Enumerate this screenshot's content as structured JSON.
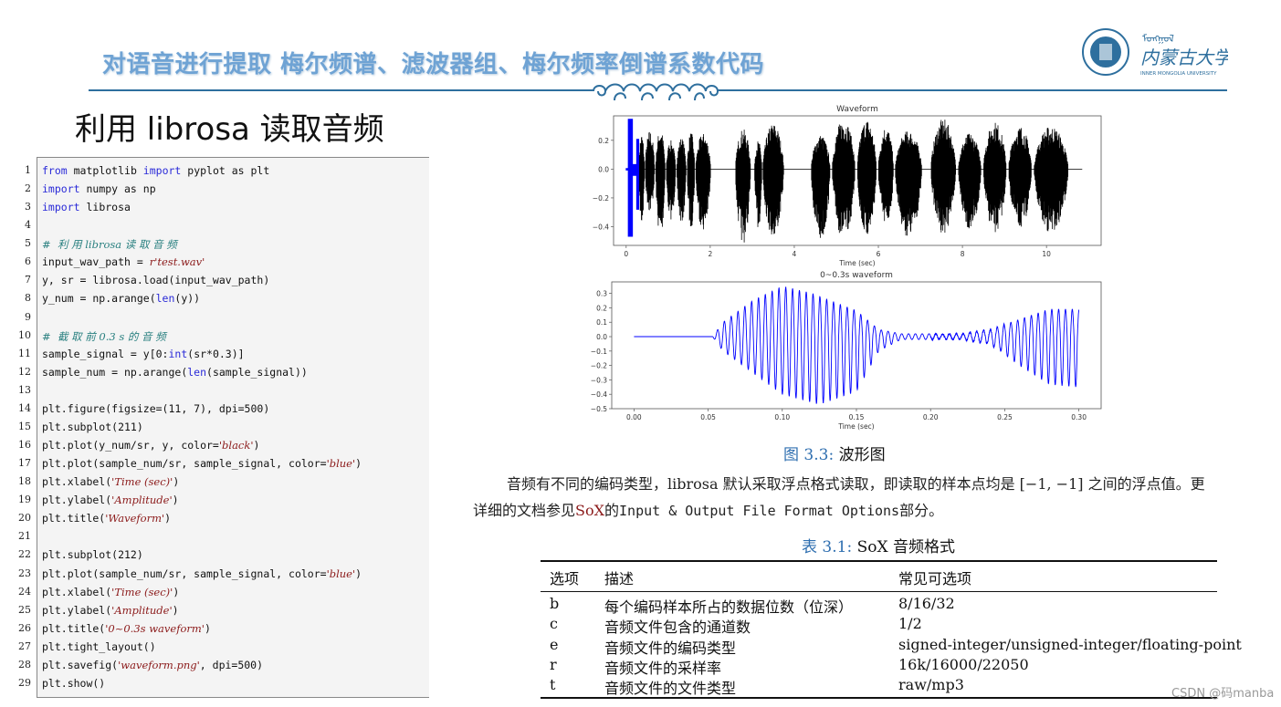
{
  "header": {
    "title": "对语音进行提取  梅尔频谱、滤波器组、梅尔频率倒谱系数代码",
    "logo_text": "内蒙古大学 INNER MONGOLIA UNIVERSITY",
    "accent_color": "#2e6f9e",
    "title_color": "#6fa3d4"
  },
  "section_heading": "利用 librosa 读取音频",
  "code": {
    "line_numbers": [
      "1",
      "2",
      "3",
      "4",
      "5",
      "6",
      "7",
      "8",
      "9",
      "10",
      "11",
      "12",
      "13",
      "14",
      "15",
      "16",
      "17",
      "18",
      "19",
      "20",
      "21",
      "22",
      "23",
      "24",
      "25",
      "26",
      "27",
      "28",
      "29"
    ],
    "lines": [
      [
        [
          "kw",
          "from"
        ],
        [
          "t",
          " matplotlib "
        ],
        [
          "kw",
          "import"
        ],
        [
          "t",
          " pyplot as plt"
        ]
      ],
      [
        [
          "kw",
          "import"
        ],
        [
          "t",
          " numpy as np"
        ]
      ],
      [
        [
          "kw",
          "import"
        ],
        [
          "t",
          " librosa"
        ]
      ],
      [],
      [
        [
          "cm",
          "#  利 用 librosa 读 取 音 频"
        ]
      ],
      [
        [
          "t",
          "input_wav_path = "
        ],
        [
          "st",
          "r'test.wav'"
        ]
      ],
      [
        [
          "t",
          "y, sr = librosa.load(input_wav_path)"
        ]
      ],
      [
        [
          "t",
          "y_num = np.arange("
        ],
        [
          "kw",
          "len"
        ],
        [
          "t",
          "(y))"
        ]
      ],
      [],
      [
        [
          "cm",
          "#  截 取 前 0.3 s 的 音 频"
        ]
      ],
      [
        [
          "t",
          "sample_signal = y[0:"
        ],
        [
          "kw",
          "int"
        ],
        [
          "t",
          "(sr*0.3)]"
        ]
      ],
      [
        [
          "t",
          "sample_num = np.arange("
        ],
        [
          "kw",
          "len"
        ],
        [
          "t",
          "(sample_signal))"
        ]
      ],
      [],
      [
        [
          "t",
          "plt.figure(figsize=(11, 7), dpi=500)"
        ]
      ],
      [
        [
          "t",
          "plt.subplot(211)"
        ]
      ],
      [
        [
          "t",
          "plt.plot(y_num/sr, y, color="
        ],
        [
          "st",
          "'black'"
        ],
        [
          "t",
          ")"
        ]
      ],
      [
        [
          "t",
          "plt.plot(sample_num/sr, sample_signal, color="
        ],
        [
          "st",
          "'blue'"
        ],
        [
          "t",
          ")"
        ]
      ],
      [
        [
          "t",
          "plt.xlabel("
        ],
        [
          "st",
          "'Time (sec)'"
        ],
        [
          "t",
          ")"
        ]
      ],
      [
        [
          "t",
          "plt.ylabel("
        ],
        [
          "st",
          "'Amplitude'"
        ],
        [
          "t",
          ")"
        ]
      ],
      [
        [
          "t",
          "plt.title("
        ],
        [
          "st",
          "'Waveform'"
        ],
        [
          "t",
          ")"
        ]
      ],
      [],
      [
        [
          "t",
          "plt.subplot(212)"
        ]
      ],
      [
        [
          "t",
          "plt.plot(sample_num/sr, sample_signal, color="
        ],
        [
          "st",
          "'blue'"
        ],
        [
          "t",
          ")"
        ]
      ],
      [
        [
          "t",
          "plt.xlabel("
        ],
        [
          "st",
          "'Time (sec)'"
        ],
        [
          "t",
          ")"
        ]
      ],
      [
        [
          "t",
          "plt.ylabel("
        ],
        [
          "st",
          "'Amplitude'"
        ],
        [
          "t",
          ")"
        ]
      ],
      [
        [
          "t",
          "plt.title("
        ],
        [
          "st",
          "'0~0.3s waveform'"
        ],
        [
          "t",
          ")"
        ]
      ],
      [
        [
          "t",
          "plt.tight_layout()"
        ]
      ],
      [
        [
          "t",
          "plt.savefig("
        ],
        [
          "st",
          "'waveform.png'"
        ],
        [
          "t",
          ", dpi=500)"
        ]
      ],
      [
        [
          "t",
          "plt.show()"
        ]
      ]
    ]
  },
  "chart_data": [
    {
      "type": "line",
      "title": "Waveform",
      "xlabel": "Time (sec)",
      "ylabel": "",
      "xlim": [
        -0.3,
        11.3
      ],
      "ylim": [
        -0.53,
        0.37
      ],
      "xticks": [
        0,
        2,
        4,
        6,
        8,
        10
      ],
      "xtick_labels": [
        "0",
        "2",
        "4",
        "6",
        "8",
        "10"
      ],
      "yticks": [
        0.2,
        0.0,
        -0.2,
        -0.4
      ],
      "ytick_labels": [
        "0.2",
        "0.0",
        "−0.2",
        "−0.4"
      ],
      "grid": false,
      "series": [
        {
          "color": "#000000",
          "x_range": [
            0,
            10.85
          ],
          "bursts": [
            [
              0.3,
              0.45,
              0.25,
              -0.4
            ],
            [
              0.45,
              0.7,
              0.27,
              -0.3
            ],
            [
              0.7,
              0.95,
              0.28,
              -0.48
            ],
            [
              0.95,
              1.2,
              0.2,
              -0.35
            ],
            [
              1.2,
              1.45,
              0.22,
              -0.38
            ],
            [
              1.45,
              1.65,
              0.26,
              -0.42
            ],
            [
              1.65,
              2.05,
              0.25,
              -0.43
            ],
            [
              2.6,
              3.0,
              0.28,
              -0.52
            ],
            [
              3.05,
              3.25,
              0.2,
              -0.42
            ],
            [
              3.25,
              3.8,
              0.32,
              -0.48
            ],
            [
              4.4,
              4.9,
              0.24,
              -0.5
            ],
            [
              4.9,
              5.5,
              0.35,
              -0.5
            ],
            [
              5.5,
              6.0,
              0.35,
              -0.48
            ],
            [
              6.0,
              6.4,
              0.3,
              -0.4
            ],
            [
              6.4,
              7.1,
              0.27,
              -0.48
            ],
            [
              7.25,
              7.9,
              0.35,
              -0.45
            ],
            [
              7.9,
              8.5,
              0.25,
              -0.42
            ],
            [
              8.5,
              9.1,
              0.33,
              -0.45
            ],
            [
              9.1,
              9.7,
              0.3,
              -0.42
            ],
            [
              9.7,
              10.6,
              0.3,
              -0.45
            ]
          ]
        },
        {
          "color": "#0000ff",
          "x_range": [
            0,
            0.3
          ]
        }
      ]
    },
    {
      "type": "line",
      "title": "0~0.3s waveform",
      "xlabel": "Time (sec)",
      "ylabel": "",
      "xlim": [
        -0.015,
        0.315
      ],
      "ylim": [
        -0.5,
        0.38
      ],
      "xticks": [
        0.0,
        0.05,
        0.1,
        0.15,
        0.2,
        0.25,
        0.3
      ],
      "xtick_labels": [
        "0.00",
        "0.05",
        "0.10",
        "0.15",
        "0.20",
        "0.25",
        "0.30"
      ],
      "yticks": [
        0.3,
        0.2,
        0.1,
        0.0,
        -0.1,
        -0.2,
        -0.3,
        -0.4,
        -0.5
      ],
      "ytick_labels": [
        "0.3",
        "0.2",
        "0.1",
        "0.0",
        "−0.1",
        "−0.2",
        "−0.3",
        "−0.4",
        "−0.5"
      ],
      "grid": false,
      "series": [
        {
          "color": "#0000ff",
          "x_range": [
            0,
            0.3
          ],
          "period_sec": 0.0046,
          "envelope_pos": [
            [
              0,
              0
            ],
            [
              0.053,
              0
            ],
            [
              0.06,
              0.1
            ],
            [
              0.08,
              0.25
            ],
            [
              0.1,
              0.35
            ],
            [
              0.12,
              0.3
            ],
            [
              0.15,
              0.18
            ],
            [
              0.165,
              0.05
            ],
            [
              0.18,
              0.02
            ],
            [
              0.22,
              0.02
            ],
            [
              0.24,
              0.05
            ],
            [
              0.26,
              0.12
            ],
            [
              0.28,
              0.19
            ],
            [
              0.3,
              0.19
            ]
          ],
          "envelope_neg": [
            [
              0,
              0
            ],
            [
              0.053,
              0
            ],
            [
              0.06,
              -0.1
            ],
            [
              0.08,
              -0.25
            ],
            [
              0.1,
              -0.4
            ],
            [
              0.125,
              -0.47
            ],
            [
              0.15,
              -0.38
            ],
            [
              0.165,
              -0.1
            ],
            [
              0.18,
              -0.02
            ],
            [
              0.22,
              -0.02
            ],
            [
              0.24,
              -0.05
            ],
            [
              0.26,
              -0.2
            ],
            [
              0.28,
              -0.33
            ],
            [
              0.3,
              -0.35
            ]
          ]
        }
      ]
    }
  ],
  "figure_caption": {
    "label": "图 3.3:",
    "text": " 波形图"
  },
  "paragraph": {
    "line1": "音频有不同的编码类型，librosa 默认采取浮点格式读取，即读取的样本点均是 [−1, −1] 之间的浮点值。更",
    "line2_a": "详细的文档参见",
    "line2_link": "SoX",
    "line2_b": "的",
    "line2_mono": "Input & Output File Format Options",
    "line2_c": "部分。"
  },
  "table": {
    "caption_label": "表 3.1:",
    "caption_text": " SoX 音频格式",
    "headers": [
      "选项",
      "描述",
      "常见可选项"
    ],
    "rows": [
      [
        "b",
        "每个编码样本所占的数据位数（位深）",
        "8/16/32"
      ],
      [
        "c",
        "音频文件包含的通道数",
        "1/2"
      ],
      [
        "e",
        "音频文件的编码类型",
        "signed-integer/unsigned-integer/floating-point"
      ],
      [
        "r",
        "音频文件的采样率",
        "16k/16000/22050"
      ],
      [
        "t",
        "音频文件的文件类型",
        "raw/mp3"
      ]
    ]
  },
  "watermark": "CSDN @码manba"
}
